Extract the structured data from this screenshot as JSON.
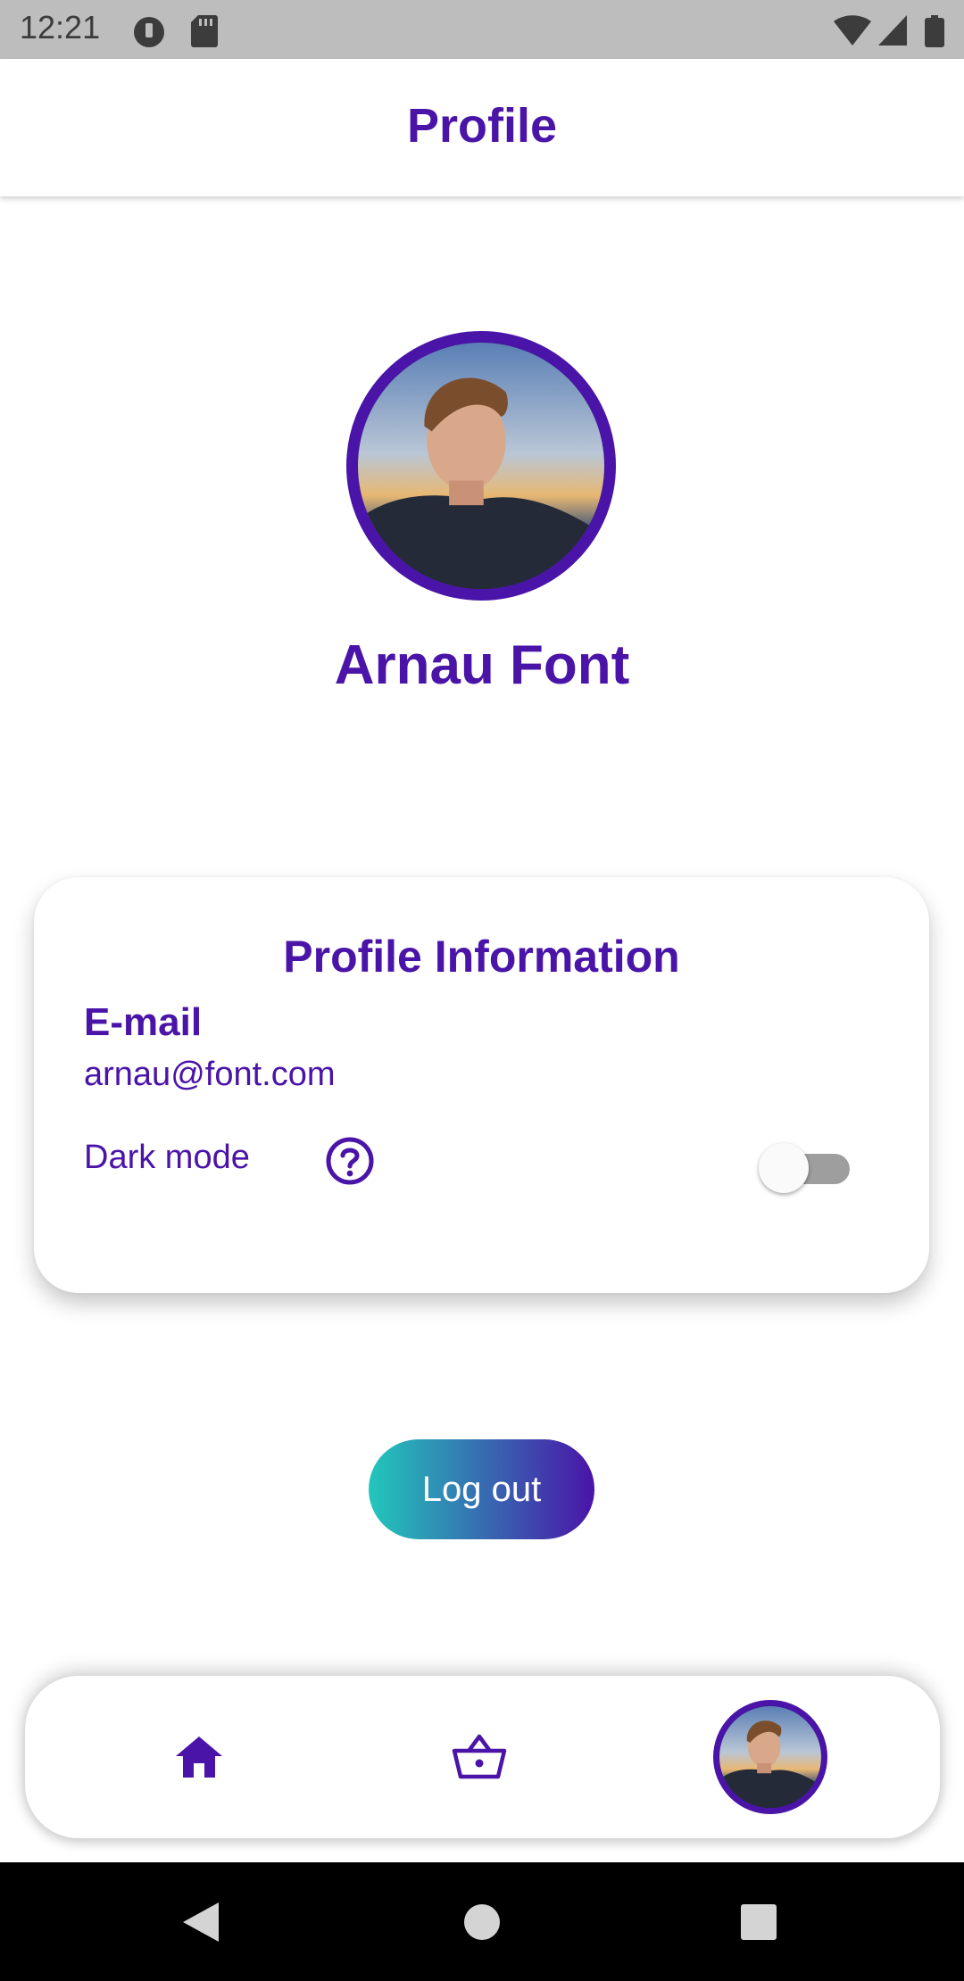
{
  "status_bar": {
    "time": "12:21",
    "left_icons": [
      "data-saver-icon",
      "sd-card-icon"
    ],
    "right_icons": [
      "wifi-icon",
      "cellular-signal-icon",
      "battery-icon"
    ]
  },
  "app_bar": {
    "title": "Profile"
  },
  "profile": {
    "name": "Arnau Font"
  },
  "card": {
    "title": "Profile Information",
    "email_label": "E-mail",
    "email_value": "arnau@font.com",
    "dark_mode_label": "Dark mode",
    "dark_mode_enabled": false
  },
  "logout": {
    "label": "Log out"
  },
  "bottom_nav": {
    "items": [
      {
        "icon": "home-icon",
        "active": false
      },
      {
        "icon": "basket-icon",
        "active": false
      },
      {
        "icon": "profile-avatar",
        "active": true
      }
    ]
  },
  "system_nav": [
    "back-icon",
    "home-circle-icon",
    "recents-icon"
  ],
  "colors": {
    "primary": "#4a14a8",
    "gradient_start": "#22c7bb",
    "gradient_end": "#4a14a8",
    "status_bar": "#bdbdbd"
  }
}
